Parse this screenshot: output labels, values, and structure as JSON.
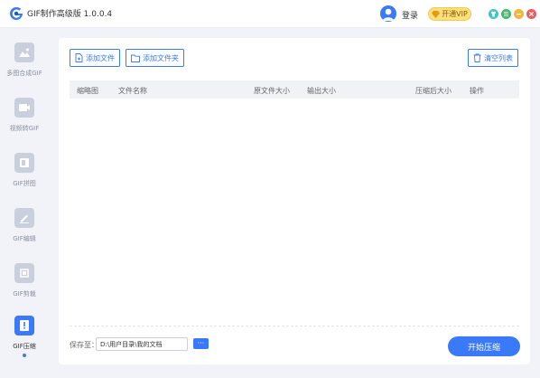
{
  "app": {
    "title": "GIF制作高级版 1.0.0.4",
    "login_label": "登录",
    "vip_label": "开通VIP"
  },
  "window_controls": [
    {
      "name": "skin-button",
      "color": "#3ec7c7"
    },
    {
      "name": "menu-button",
      "color": "#3bbf6a"
    },
    {
      "name": "minimize-button",
      "color": "#f3b63a"
    },
    {
      "name": "close-button",
      "color": "#f25a5a"
    }
  ],
  "sidebar": {
    "items": [
      {
        "label": "多图合成GIF",
        "icon": "image-icon",
        "active": false
      },
      {
        "label": "视频转GIF",
        "icon": "video-icon",
        "active": false
      },
      {
        "label": "GIF拼图",
        "icon": "puzzle-icon",
        "active": false
      },
      {
        "label": "GIF编辑",
        "icon": "edit-icon",
        "active": false
      },
      {
        "label": "GIF剪裁",
        "icon": "crop-icon",
        "active": false
      },
      {
        "label": "GIF压缩",
        "icon": "compress-icon",
        "active": true
      }
    ]
  },
  "toolbar": {
    "add_file_label": "添加文件",
    "add_folder_label": "添加文件夹",
    "clear_list_label": "清空列表"
  },
  "table": {
    "columns": [
      "缩略图",
      "文件名称",
      "原文件大小",
      "输出大小",
      "压缩后大小",
      "操作"
    ],
    "rows": []
  },
  "footer": {
    "save_to_label": "保存至：",
    "save_path": "D:\\用户目录\\我的文档",
    "browse_label": "···",
    "start_label": "开始压缩"
  },
  "colors": {
    "accent": "#3a79f7",
    "vip": "#fde07c"
  }
}
